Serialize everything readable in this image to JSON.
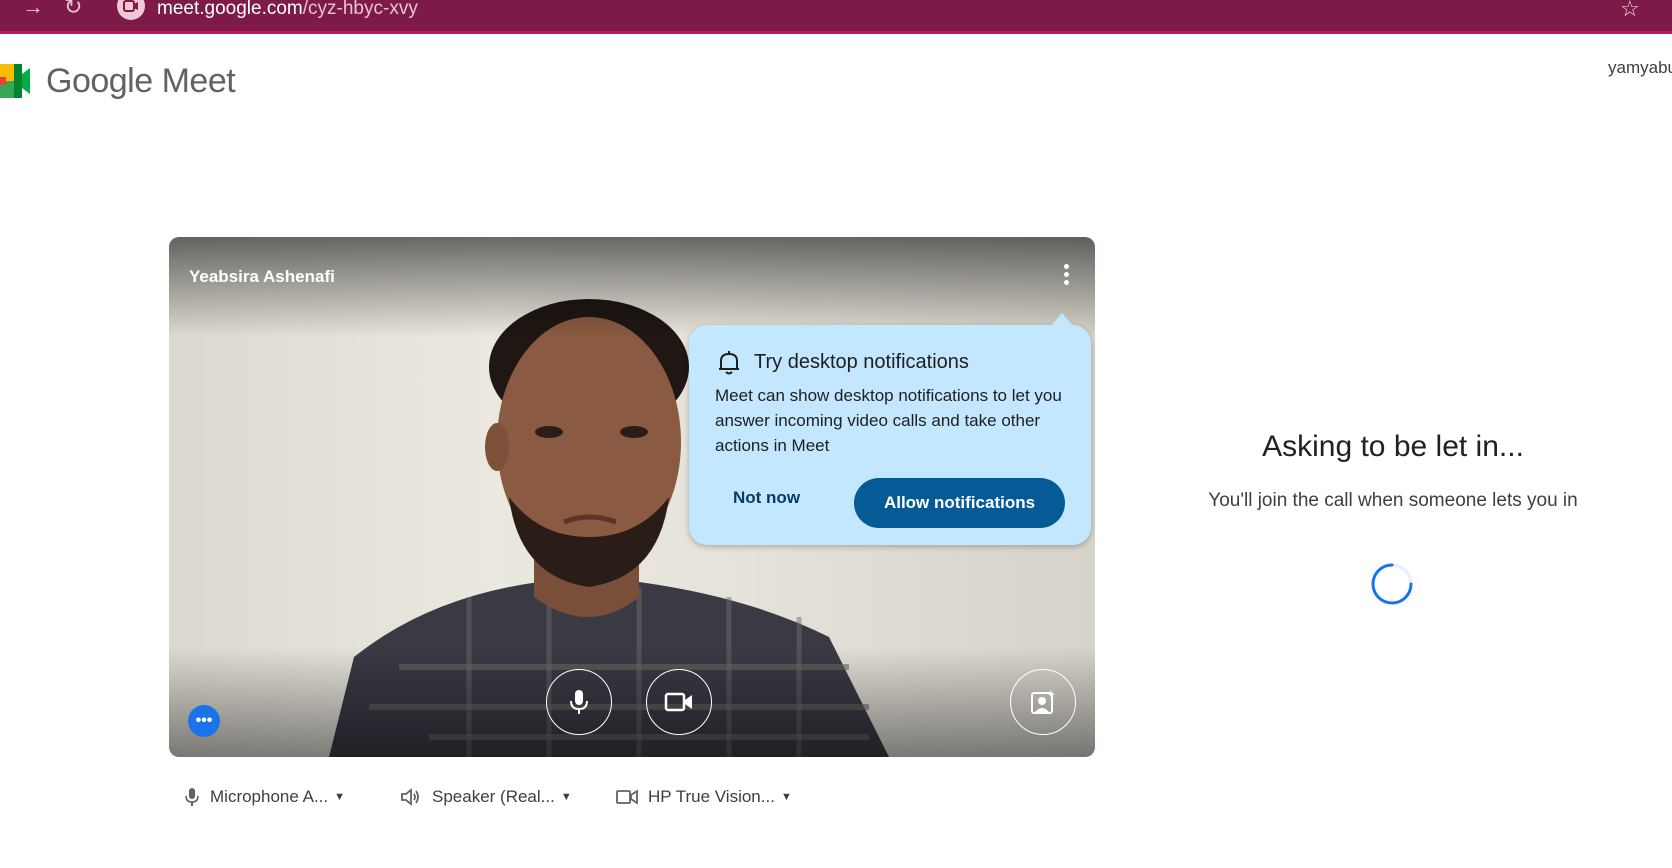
{
  "browser": {
    "url_domain": "meet.google.com",
    "url_path": "/cyz-hbyc-xvy"
  },
  "header": {
    "brand": "Google Meet",
    "account": "yamyabu"
  },
  "preview": {
    "participant_name": "Yeabsira Ashenafi"
  },
  "popup": {
    "title": "Try desktop notifications",
    "body": "Meet can show desktop notifications to let you answer incoming video calls and take other actions in Meet",
    "not_now": "Not now",
    "allow": "Allow notifications"
  },
  "devices": {
    "microphone": "Microphone A...",
    "speaker": "Speaker (Real...",
    "camera": "HP True Vision..."
  },
  "status": {
    "title": "Asking to be let in...",
    "subtitle": "You'll join the call when someone lets you in"
  },
  "colors": {
    "browser_bar": "#7e1a47",
    "popup_bg": "#c2e7ff",
    "allow_button": "#065a95",
    "spinner": "#1a73e8"
  }
}
